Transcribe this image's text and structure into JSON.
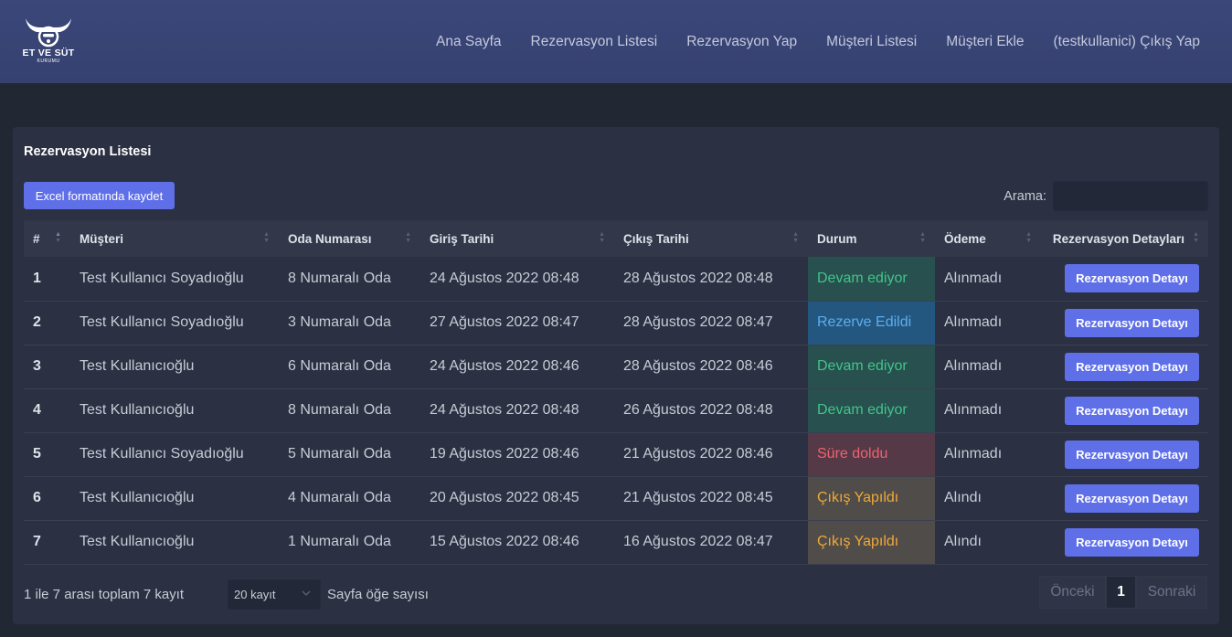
{
  "brand": {
    "logo_text": "ET VE SÜT",
    "logo_sub": "KURUMU"
  },
  "nav": {
    "items": [
      "Ana Sayfa",
      "Rezervasyon Listesi",
      "Rezervasyon Yap",
      "Müşteri Listesi",
      "Müşteri Ekle",
      "(testkullanici) Çıkış Yap"
    ]
  },
  "card": {
    "title": "Rezervasyon Listesi",
    "excel_button": "Excel formatında kaydet",
    "search_label": "Arama:",
    "search_value": ""
  },
  "table": {
    "headers": [
      "#",
      "Müşteri",
      "Oda Numarası",
      "Giriş Tarihi",
      "Çıkış Tarihi",
      "Durum",
      "Ödeme",
      "Rezervasyon Detayları"
    ],
    "rows": [
      {
        "no": "1",
        "customer": "Test Kullanıcı Soyadıoğlu",
        "room": "8 Numaralı Oda",
        "checkin": "24 Ağustos 2022 08:48",
        "checkout": "28 Ağustos 2022 08:48",
        "status": "Devam ediyor",
        "status_kind": "devam",
        "payment": "Alınmadı",
        "detail": "Rezervasyon Detayı"
      },
      {
        "no": "2",
        "customer": "Test Kullanıcı Soyadıoğlu",
        "room": "3 Numaralı Oda",
        "checkin": "27 Ağustos 2022 08:47",
        "checkout": "28 Ağustos 2022 08:47",
        "status": "Rezerve Edildi",
        "status_kind": "rezerve",
        "payment": "Alınmadı",
        "detail": "Rezervasyon Detayı"
      },
      {
        "no": "3",
        "customer": "Test Kullanıcıoğlu",
        "room": "6 Numaralı Oda",
        "checkin": "24 Ağustos 2022 08:46",
        "checkout": "28 Ağustos 2022 08:46",
        "status": "Devam ediyor",
        "status_kind": "devam",
        "payment": "Alınmadı",
        "detail": "Rezervasyon Detayı"
      },
      {
        "no": "4",
        "customer": "Test Kullanıcıoğlu",
        "room": "8 Numaralı Oda",
        "checkin": "24 Ağustos 2022 08:48",
        "checkout": "26 Ağustos 2022 08:48",
        "status": "Devam ediyor",
        "status_kind": "devam",
        "payment": "Alınmadı",
        "detail": "Rezervasyon Detayı"
      },
      {
        "no": "5",
        "customer": "Test Kullanıcı Soyadıoğlu",
        "room": "5 Numaralı Oda",
        "checkin": "19 Ağustos 2022 08:46",
        "checkout": "21 Ağustos 2022 08:46",
        "status": "Süre doldu",
        "status_kind": "sure",
        "payment": "Alınmadı",
        "detail": "Rezervasyon Detayı"
      },
      {
        "no": "6",
        "customer": "Test Kullanıcıoğlu",
        "room": "4 Numaralı Oda",
        "checkin": "20 Ağustos 2022 08:45",
        "checkout": "21 Ağustos 2022 08:45",
        "status": "Çıkış Yapıldı",
        "status_kind": "cikis",
        "payment": "Alındı",
        "detail": "Rezervasyon Detayı"
      },
      {
        "no": "7",
        "customer": "Test Kullanıcıoğlu",
        "room": "1 Numaralı Oda",
        "checkin": "15 Ağustos 2022 08:46",
        "checkout": "16 Ağustos 2022 08:47",
        "status": "Çıkış Yapıldı",
        "status_kind": "cikis",
        "payment": "Alındı",
        "detail": "Rezervasyon Detayı"
      }
    ]
  },
  "footer": {
    "info": "1 ile 7 arası toplam 7 kayıt",
    "length_value": "20 kayıt",
    "length_label": "Sayfa öğe sayısı",
    "prev": "Önceki",
    "page": "1",
    "next": "Sonraki"
  },
  "colors": {
    "navbar": "#3a4779",
    "background": "#222734",
    "card": "#2b3042",
    "accent": "#5e6fe8",
    "status_devam": "#42c488",
    "status_rezerve": "#5aaeee",
    "status_sure": "#ee6270",
    "status_cikis": "#f0a936"
  }
}
